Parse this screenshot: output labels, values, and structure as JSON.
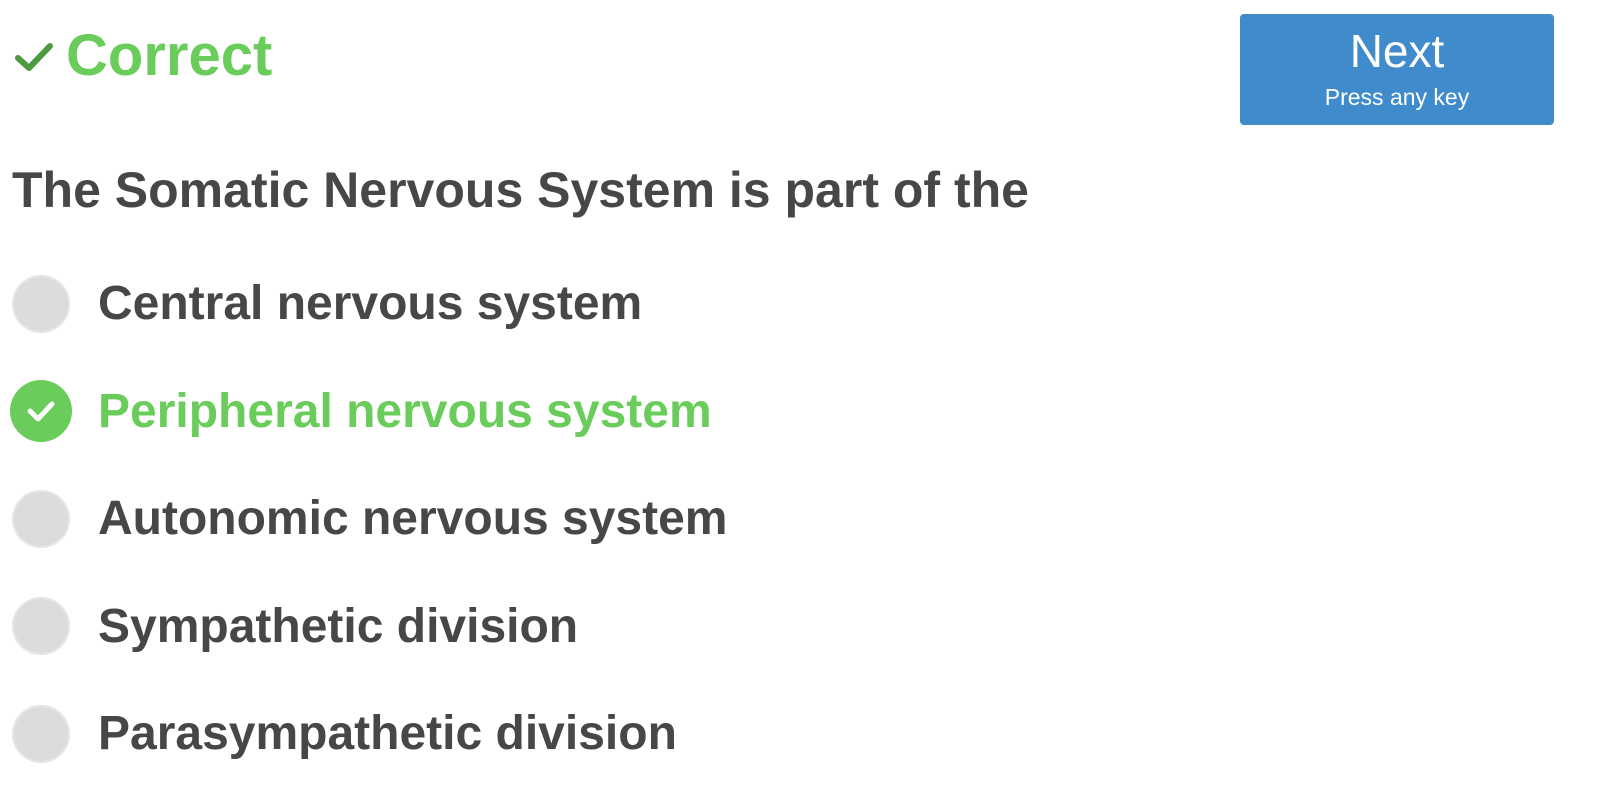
{
  "feedback": {
    "icon": "checkmark-icon",
    "text": "Correct",
    "color": "#6acc5a"
  },
  "next_button": {
    "label": "Next",
    "hint": "Press any key",
    "color": "#3f8bcb"
  },
  "question": {
    "text": "The Somatic Nervous System is part of the"
  },
  "options": [
    {
      "label": "Central nervous system",
      "selected": false,
      "correct": false
    },
    {
      "label": "Peripheral nervous system",
      "selected": true,
      "correct": true
    },
    {
      "label": "Autonomic nervous system",
      "selected": false,
      "correct": false
    },
    {
      "label": "Sympathetic division",
      "selected": false,
      "correct": false
    },
    {
      "label": "Parasympathetic division",
      "selected": false,
      "correct": false
    }
  ],
  "colors": {
    "correct": "#6acc5a",
    "text": "#474747",
    "radio_unselected": "#dcdcdc",
    "button": "#3f8bcb"
  }
}
